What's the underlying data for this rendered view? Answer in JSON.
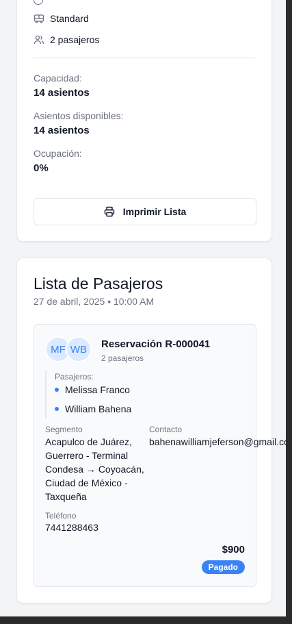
{
  "trip": {
    "service_type": "Standard",
    "passengers_summary": "2 pasajeros",
    "capacity_label": "Capacidad:",
    "capacity_value": "14 asientos",
    "available_label": "Asientos disponibles:",
    "available_value": "14 asientos",
    "occupancy_label": "Ocupación:",
    "occupancy_value": "0%",
    "print_button": "Imprimir Lista"
  },
  "passenger_list": {
    "title": "Lista de Pasajeros",
    "datetime": "27 de abril, 2025 • 10:00 AM",
    "reservations": [
      {
        "avatars": [
          "MF",
          "WB"
        ],
        "title": "Reservación R-000041",
        "subtitle": "2 pasajeros",
        "passengers_label": "Pasajeros:",
        "passengers": [
          "Melissa Franco",
          "William Bahena"
        ],
        "segment_label": "Segmento",
        "segment_value": "Acapulco de Juárez, Guerrero - Terminal Condesa → Coyoacán, Ciudad de México - Taxqueña",
        "contact_label": "Contacto",
        "contact_value": "bahenawilliamjeferson@gmail.com",
        "phone_label": "Teléfono",
        "phone_value": "7441288463",
        "price": "$900",
        "status": "Pagado"
      }
    ]
  },
  "colors": {
    "accent": "#3b82f6",
    "avatar_bg": "#dbeafe",
    "muted_text": "#6b7280"
  },
  "icons": [
    "bus-icon",
    "users-icon",
    "printer-icon"
  ]
}
